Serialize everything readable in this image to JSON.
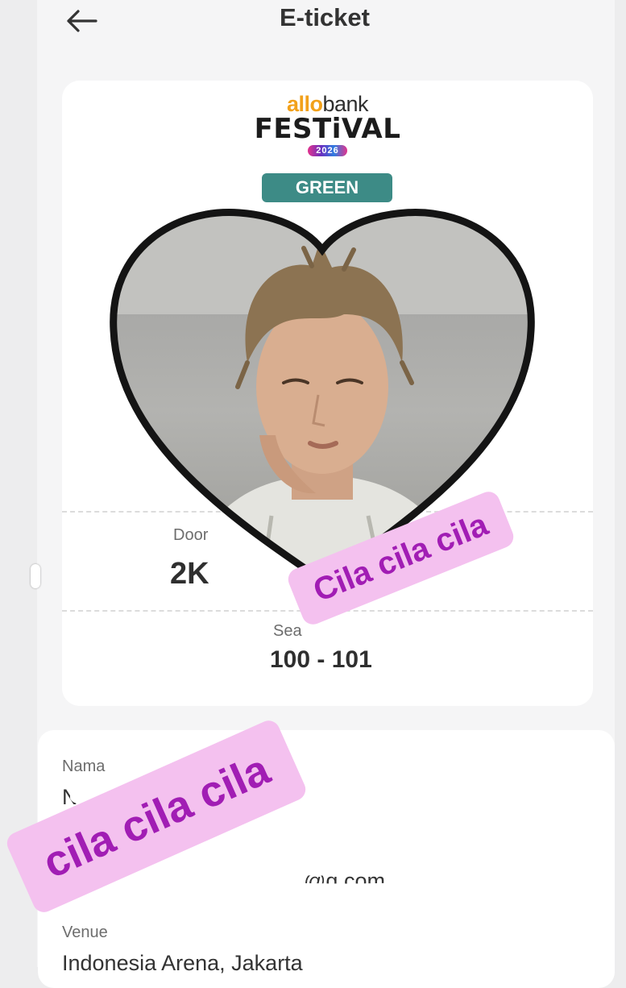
{
  "header": {
    "title": "E-ticket"
  },
  "ticket": {
    "brand_allo": "allo",
    "brand_bank": "bank",
    "brand_festival": "FESTiVAL",
    "brand_year": "2026",
    "category": "GREEN",
    "door_label": "Door",
    "door_value": "2K",
    "seat_label": "Sea",
    "seat_value": "100 - 101"
  },
  "details": {
    "name_label": "Nama",
    "name_value_partial": "N",
    "email_value_partial": "@g",
    "email_tail": ".com",
    "venue_label": "Venue",
    "venue_value": "Indonesia Arena, Jakarta"
  },
  "stickers": {
    "first": "Cila cila cila",
    "second": "cila cila cila"
  },
  "colors": {
    "badge": "#3d8b86",
    "sticker_bg": "#f4c1ef",
    "sticker_text": "#a11db4",
    "brand_orange": "#f2a11b"
  }
}
